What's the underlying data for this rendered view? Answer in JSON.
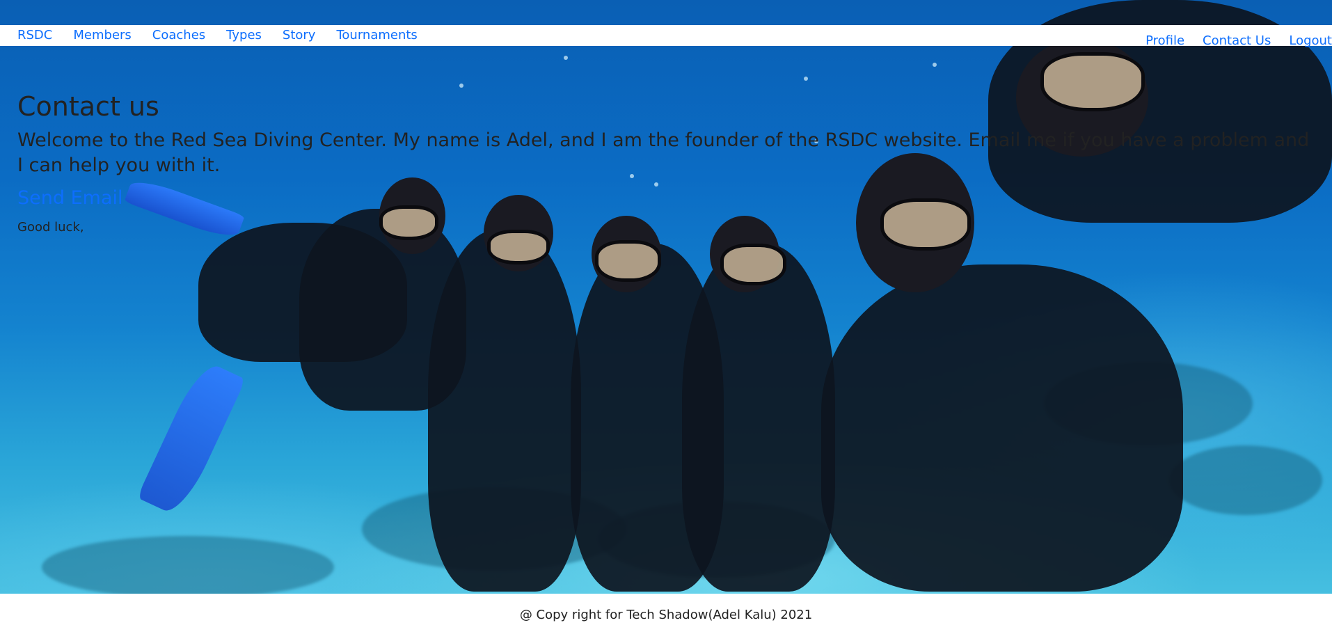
{
  "nav": {
    "left": [
      {
        "label": "RSDC",
        "name": "nav-rsdc"
      },
      {
        "label": "Members",
        "name": "nav-members"
      },
      {
        "label": "Coaches",
        "name": "nav-coaches"
      },
      {
        "label": "Types",
        "name": "nav-types"
      },
      {
        "label": "Story",
        "name": "nav-story"
      },
      {
        "label": "Tournaments",
        "name": "nav-tournaments"
      }
    ],
    "right": [
      {
        "label": "Profile",
        "name": "nav-profile"
      },
      {
        "label": "Contact Us",
        "name": "nav-contact-us"
      },
      {
        "label": "Logout",
        "name": "nav-logout"
      }
    ]
  },
  "content": {
    "title": "Contact us",
    "intro": "Welcome to the Red Sea Diving Center. My name is Adel, and I am the founder of the RSDC website. Email me if you have a problem and I can help you with it.",
    "email_link": "Send Email",
    "closing": "Good luck,"
  },
  "footer": {
    "text": "@ Copy right for Tech Shadow(Adel Kalu) 2021"
  },
  "colors": {
    "link": "#0d6efd",
    "text": "#222222",
    "sea": "#0b6cc4"
  },
  "hero_image": "group-of-scuba-divers-underwater-photo"
}
